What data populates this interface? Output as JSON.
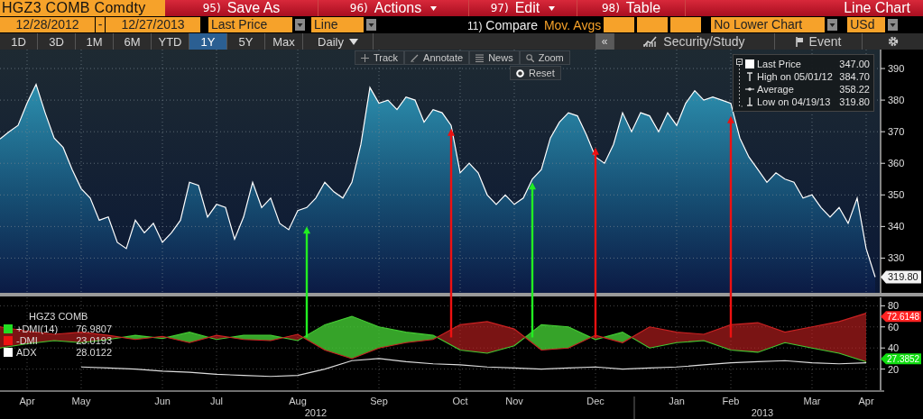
{
  "header": {
    "security": "HGZ3 COMB Comdty",
    "menu": [
      {
        "number": "95)",
        "label": "Save As",
        "caret": false
      },
      {
        "number": "96)",
        "label": "Actions",
        "caret": true
      },
      {
        "number": "97)",
        "label": "Edit",
        "caret": true
      },
      {
        "number": "98)",
        "label": "Table",
        "caret": false
      }
    ],
    "title": "Line Chart"
  },
  "controls": {
    "start_date": "12/28/2012",
    "separator": "-",
    "end_date": "12/27/2013",
    "field": "Last Price",
    "style": "Line",
    "compare_number": "11)",
    "compare": "Compare",
    "mov_avgs": "Mov. Avgs",
    "lower_chart": "No Lower Chart",
    "currency": "USd"
  },
  "periods": [
    {
      "label": "1D",
      "selected": false
    },
    {
      "label": "3D",
      "selected": false
    },
    {
      "label": "1M",
      "selected": false
    },
    {
      "label": "6M",
      "selected": false
    },
    {
      "label": "YTD",
      "selected": false
    },
    {
      "label": "1Y",
      "selected": true
    },
    {
      "label": "5Y",
      "selected": false
    },
    {
      "label": "Max",
      "selected": false
    }
  ],
  "frequency": "Daily",
  "collapse": "«",
  "study": "Security/Study",
  "event": "Event",
  "tools": [
    {
      "kind": "track",
      "label": "Track"
    },
    {
      "kind": "annotate",
      "label": "Annotate"
    },
    {
      "kind": "news",
      "label": "News"
    },
    {
      "kind": "zoom",
      "label": "Zoom"
    }
  ],
  "reset": "Reset",
  "price_legend": [
    {
      "kind": "last",
      "label": "Last Price",
      "value": "347.00"
    },
    {
      "kind": "high",
      "label": "High on 05/01/12",
      "value": "384.70"
    },
    {
      "kind": "average",
      "label": "Average",
      "value": "358.22"
    },
    {
      "kind": "low",
      "label": "Low on 04/19/13",
      "value": "319.80"
    }
  ],
  "signals": [
    {
      "kind": "buy"
    },
    {
      "kind": "sell"
    },
    {
      "kind": "buy"
    },
    {
      "kind": "sell"
    },
    {
      "kind": "sell"
    }
  ],
  "price_chart": {
    "last_tag": "319.80",
    "chart_data": {
      "type": "area",
      "grid": true,
      "ylim": [
        319,
        396
      ],
      "yticks": [
        330,
        340,
        350,
        360,
        370,
        380,
        390
      ],
      "series": [
        {
          "color": "#ffffff",
          "values": [
            367.7,
            370,
            372,
            379,
            385,
            376,
            368,
            365,
            358,
            352,
            349,
            342,
            343,
            335,
            333,
            342,
            338,
            341,
            335,
            338,
            342,
            354,
            353,
            343,
            347,
            346,
            336,
            343,
            354,
            346,
            349,
            341,
            339,
            345,
            346,
            349,
            354,
            351,
            349,
            354,
            366,
            384,
            379,
            380,
            377,
            381,
            380,
            373,
            377,
            376,
            372,
            357,
            360,
            357,
            350,
            347,
            350,
            347,
            349,
            355,
            358,
            368,
            373,
            376,
            375,
            369,
            362,
            360,
            366,
            376,
            370,
            376,
            375,
            370,
            376,
            372,
            379,
            383,
            380,
            381,
            380,
            379,
            368,
            362,
            358,
            354,
            357,
            355,
            354,
            349,
            350,
            346,
            343,
            346,
            341,
            349,
            333,
            324
          ]
        }
      ]
    }
  },
  "dmi_legend": {
    "title": "HGZ3 COMB",
    "items": [
      {
        "value": "76.9807",
        "color": "#22dd22"
      },
      {
        "value": "23.0193",
        "color": "#ee1111"
      },
      {
        "value": "28.0122",
        "color": "#ffffff"
      }
    ]
  },
  "dmi_chart": {
    "tags": [
      {
        "value": "72.6148",
        "color": "#ff2222"
      },
      {
        "value": "27.3852",
        "color": "#11dd11"
      }
    ],
    "years": [
      "2012",
      "2013"
    ],
    "chart_data": {
      "type": "line",
      "grid": true,
      "ylim": [
        0,
        88
      ],
      "yticks": [
        20,
        40,
        60,
        80
      ],
      "categories": [
        null,
        "Apr",
        null,
        "May",
        null,
        null,
        "Jun",
        null,
        "Jul",
        null,
        null,
        "Aug",
        null,
        null,
        "Sep",
        null,
        null,
        "Oct",
        null,
        "Nov",
        null,
        null,
        "Dec",
        null,
        null,
        "Jan",
        null,
        "Feb",
        null,
        null,
        "Mar",
        null,
        "Apr"
      ],
      "series": [
        {
          "name": "+DMI(14)",
          "color": "#44cc33",
          "values": [
            40,
            44,
            47,
            45,
            48,
            52,
            49,
            55,
            48,
            52,
            52,
            47,
            62,
            70,
            60,
            55,
            52,
            38,
            35,
            42,
            62,
            60,
            48,
            55,
            40,
            45,
            47,
            38,
            36,
            45,
            40,
            35,
            27
          ]
        },
        {
          "name": "-DMI",
          "color": "#cc2222",
          "values": [
            60,
            56,
            53,
            55,
            52,
            48,
            51,
            45,
            52,
            48,
            47,
            53,
            38,
            30,
            40,
            45,
            48,
            62,
            65,
            58,
            38,
            40,
            52,
            45,
            60,
            55,
            53,
            62,
            64,
            55,
            60,
            65,
            73
          ]
        },
        {
          "name": "ADX",
          "color": "#dddddd",
          "values": [
            null,
            null,
            null,
            22,
            21,
            20,
            18,
            17,
            15,
            14,
            13,
            14,
            20,
            28,
            30,
            27,
            25,
            24,
            22,
            21,
            20,
            21,
            22,
            20,
            21,
            22,
            24,
            26,
            27,
            28,
            26,
            25,
            26
          ]
        }
      ]
    }
  }
}
